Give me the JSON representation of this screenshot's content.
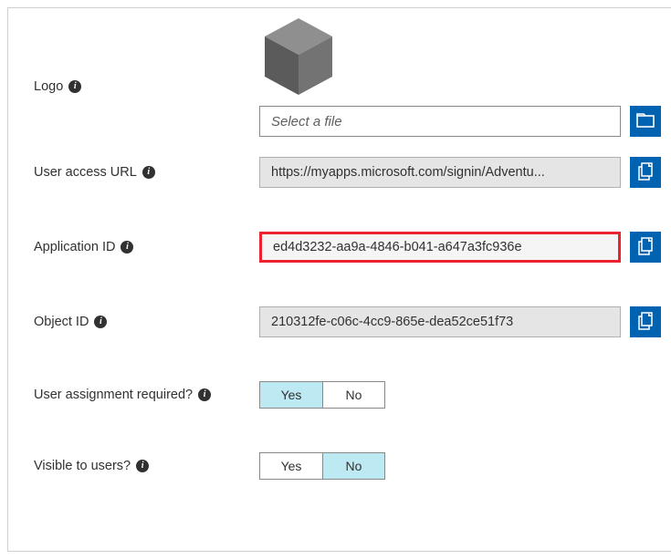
{
  "logo": {
    "label": "Logo",
    "file_placeholder": "Select a file"
  },
  "user_access_url": {
    "label": "User access URL",
    "value": "https://myapps.microsoft.com/signin/Adventu..."
  },
  "application_id": {
    "label": "Application ID",
    "value": "ed4d3232-aa9a-4846-b041-a647a3fc936e"
  },
  "object_id": {
    "label": "Object ID",
    "value": "210312fe-c06c-4cc9-865e-dea52ce51f73"
  },
  "user_assignment_required": {
    "label": "User assignment required?",
    "options": {
      "yes": "Yes",
      "no": "No"
    },
    "selected": "yes"
  },
  "visible_to_users": {
    "label": "Visible to users?",
    "options": {
      "yes": "Yes",
      "no": "No"
    },
    "selected": "no"
  },
  "colors": {
    "accent": "#0063b1",
    "highlight_border": "#eb2330",
    "toggle_selected": "#bde9f3"
  }
}
